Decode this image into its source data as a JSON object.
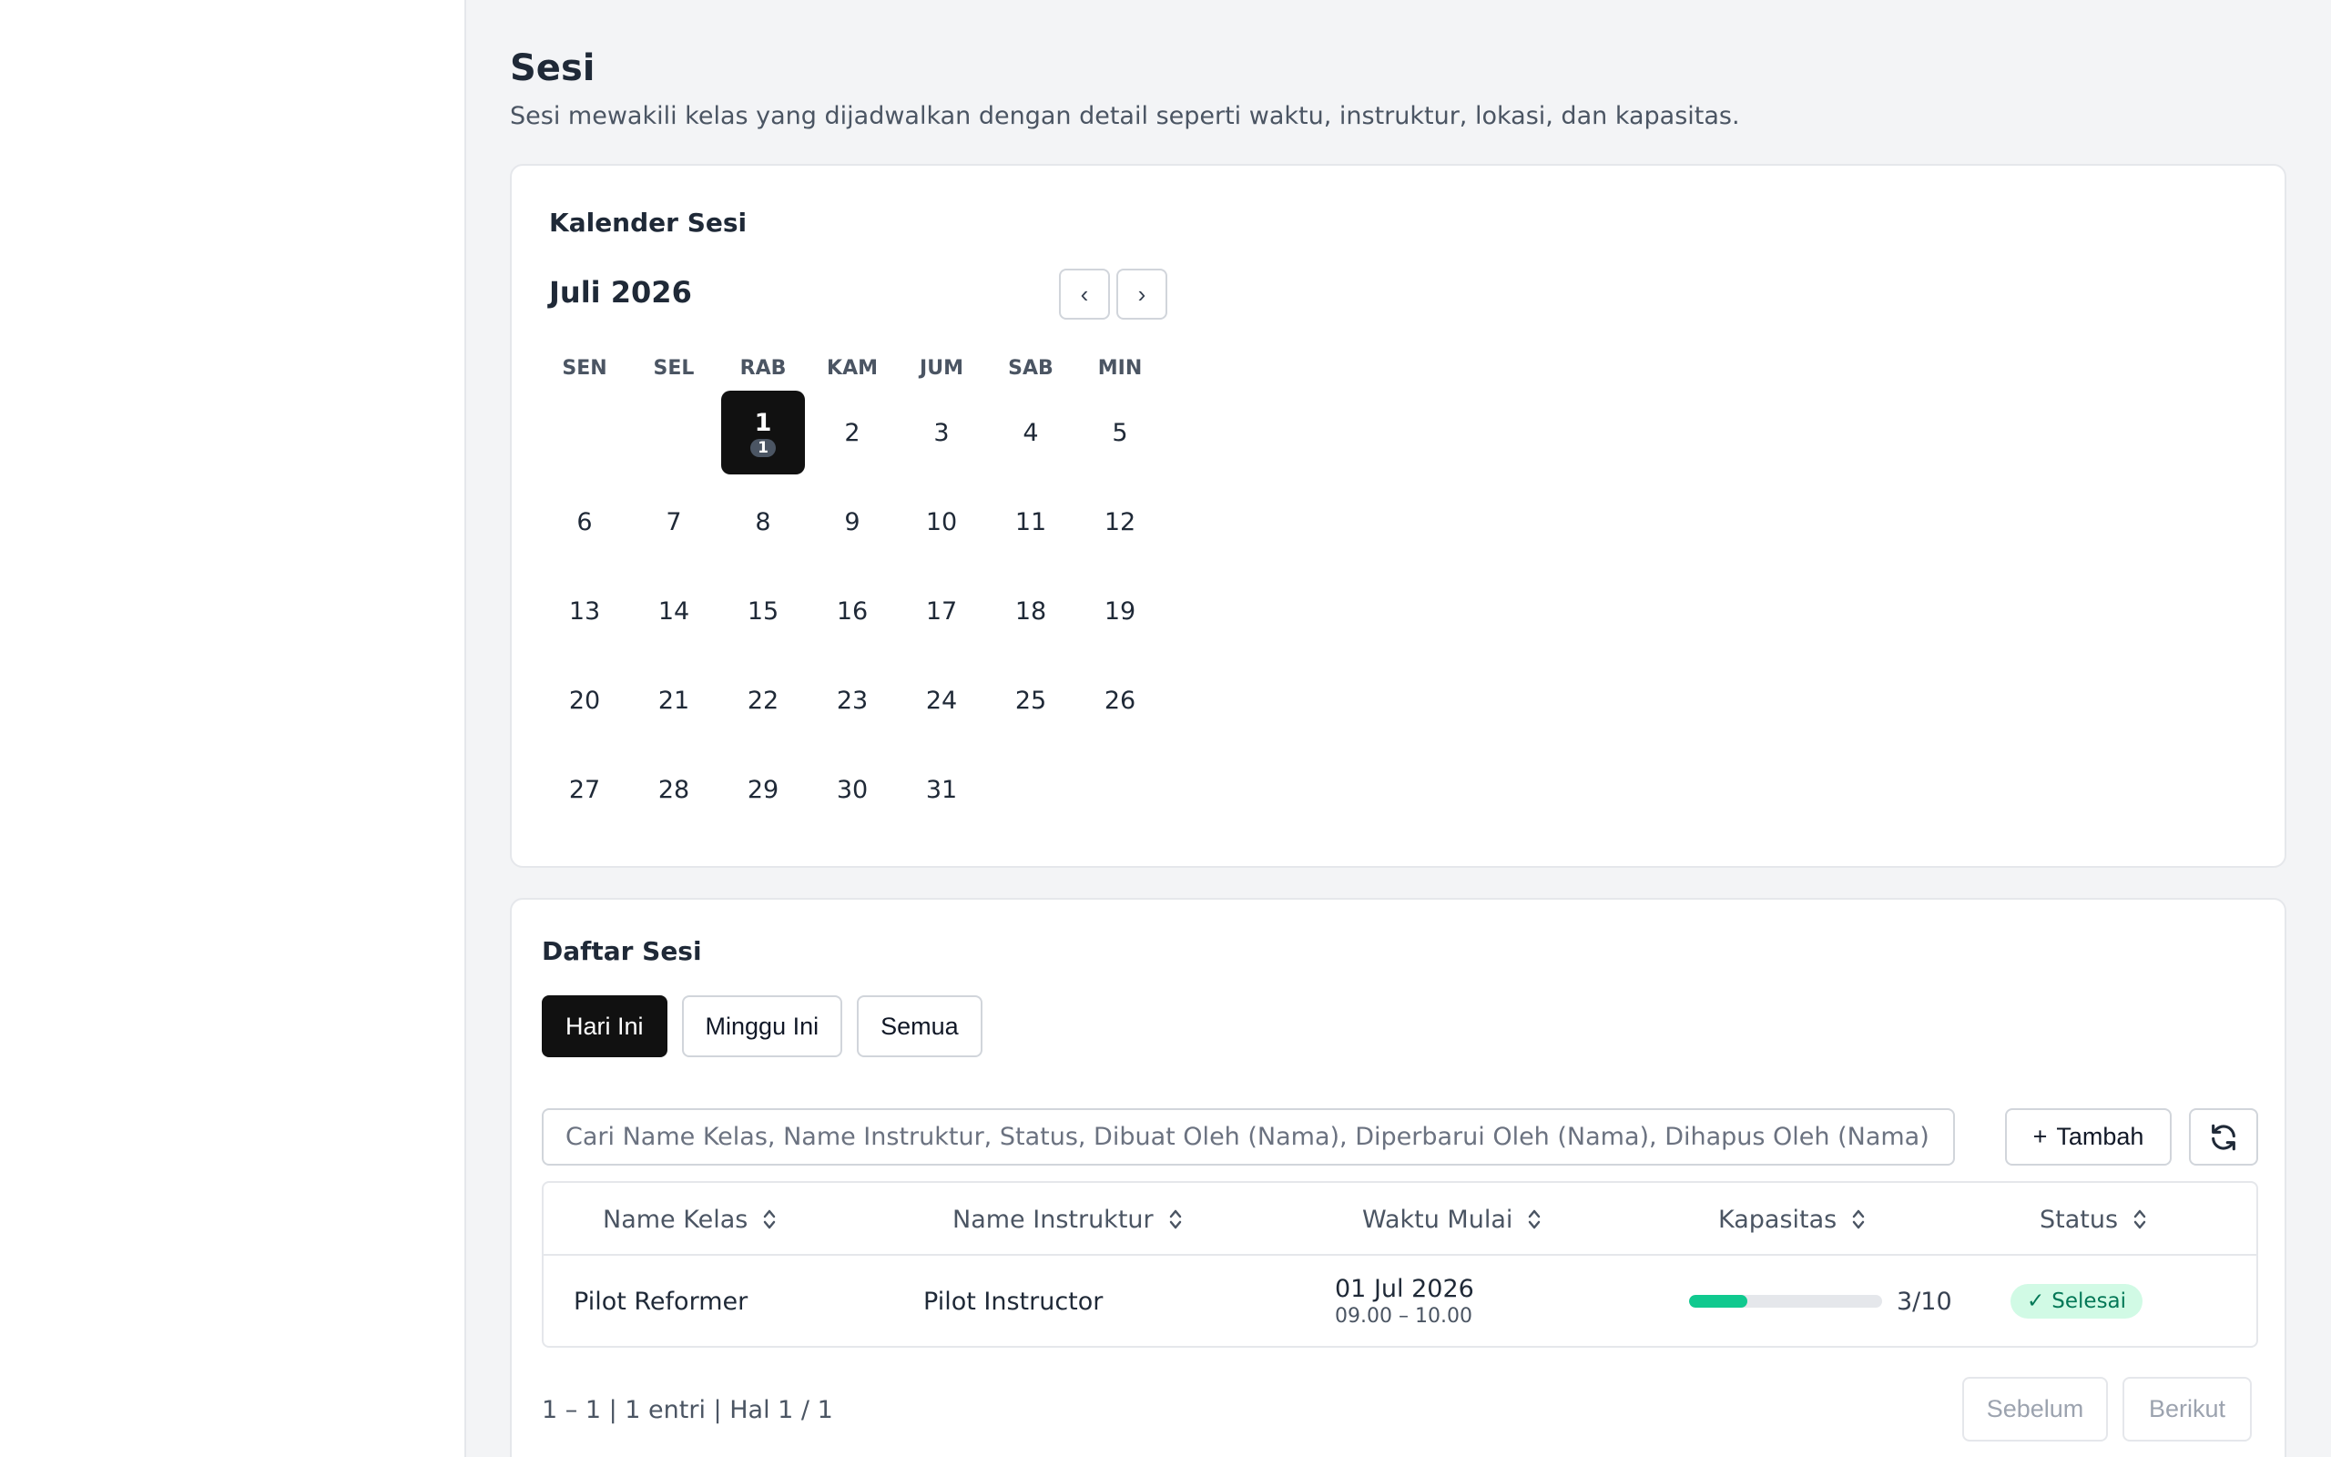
{
  "page": {
    "title": "Sesi",
    "subtitle": "Sesi mewakili kelas yang dijadwalkan dengan detail seperti waktu, instruktur, lokasi, dan kapasitas."
  },
  "calendar": {
    "card_title": "Kalender Sesi",
    "month_label": "Juli 2026",
    "prev_label": "‹",
    "next_label": "›",
    "weekdays": [
      "SEN",
      "SEL",
      "RAB",
      "KAM",
      "JUM",
      "SAB",
      "MIN"
    ],
    "leading_blanks": 2,
    "days_in_month": 31,
    "selected_day": 1,
    "session_counts": {
      "1": "1"
    }
  },
  "list": {
    "card_title": "Daftar Sesi",
    "tabs": [
      {
        "label": "Hari Ini",
        "active": true
      },
      {
        "label": "Minggu Ini",
        "active": false
      },
      {
        "label": "Semua",
        "active": false
      }
    ],
    "search_placeholder": "Cari Name Kelas, Name Instruktur, Status, Dibuat Oleh (Nama), Diperbarui Oleh (Nama), Dihapus Oleh (Nama)",
    "add_label": "Tambah",
    "add_icon": "+",
    "columns": [
      "Name Kelas",
      "Name Instruktur",
      "Waktu Mulai",
      "Kapasitas",
      "Status"
    ],
    "rows": [
      {
        "class_name": "Pilot Reformer",
        "instructor": "Pilot Instructor",
        "date": "01 Jul 2026",
        "time_range": "09.00 – 10.00",
        "capacity_text": "3/10",
        "capacity_fraction": 0.3,
        "status_icon": "✓",
        "status": "Selesai"
      }
    ],
    "pager_info": "1 – 1 | 1 entri | Hal 1 / 1",
    "prev_page_label": "Sebelum",
    "next_page_label": "Berikut"
  },
  "colors": {
    "accent_dark": "#111111",
    "capacity_fill": "#10c98f",
    "status_bg": "#d1fae5",
    "status_text": "#047857"
  }
}
